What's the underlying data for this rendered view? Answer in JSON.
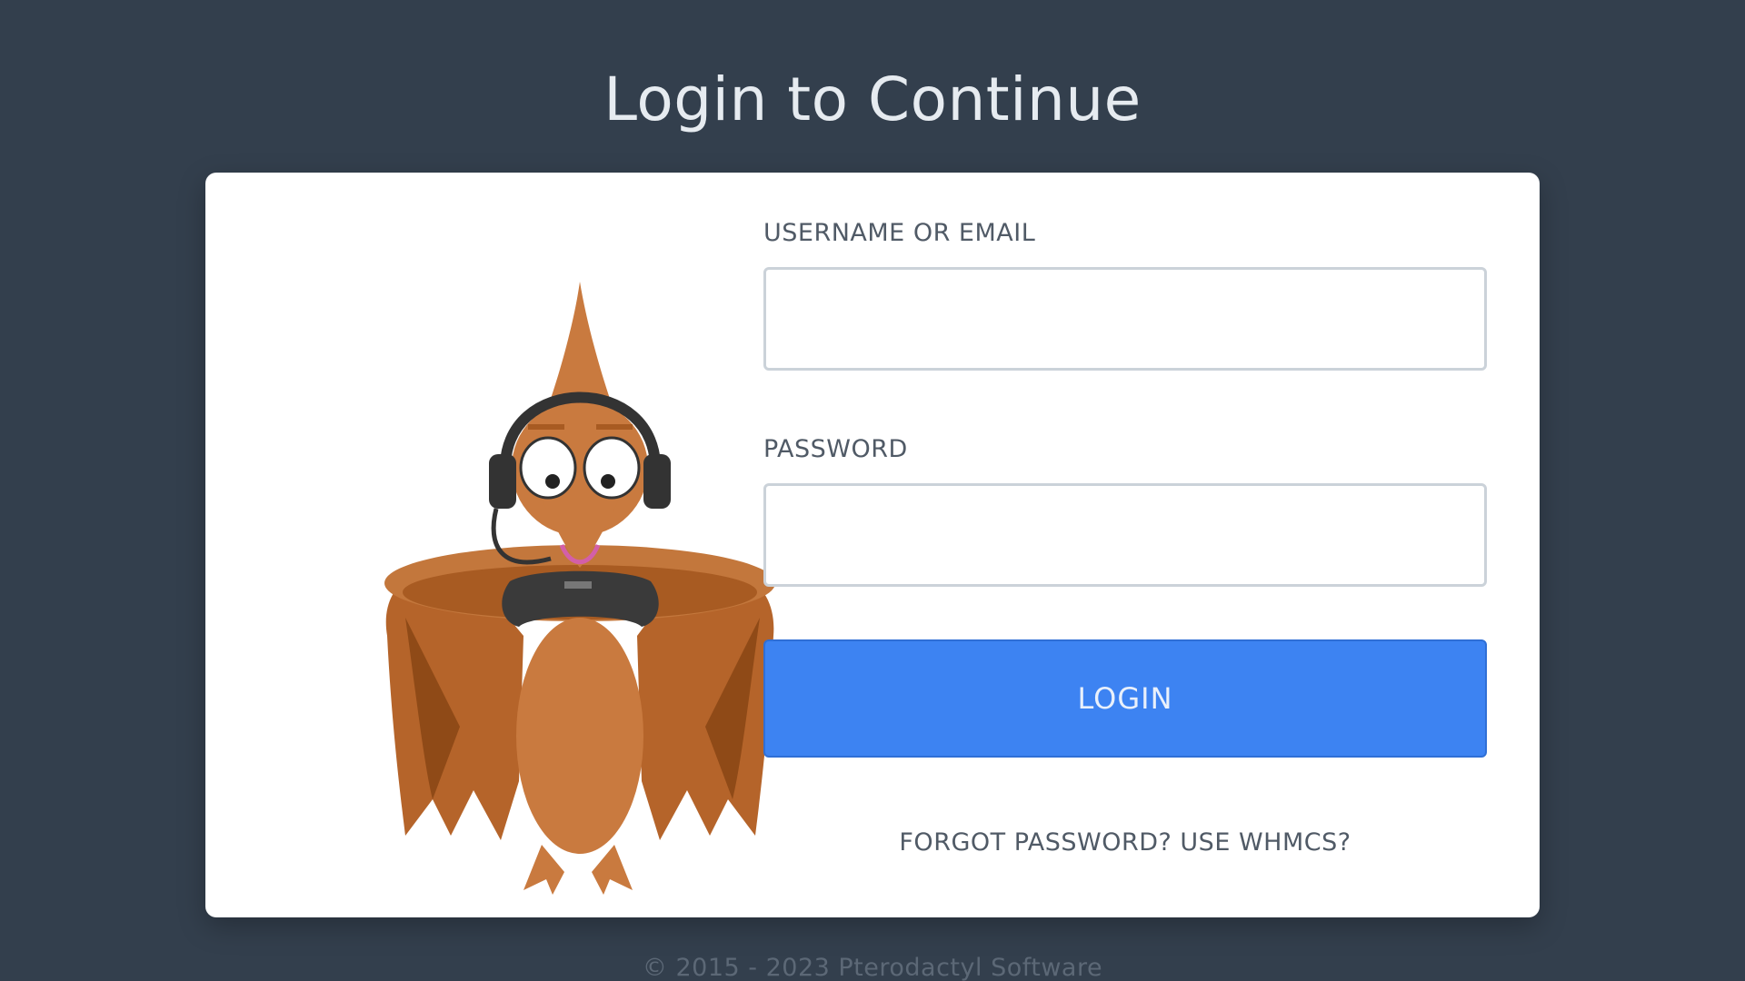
{
  "page": {
    "title": "Login to Continue",
    "background_color": "#333f4d",
    "accent_color": "#3d83f2"
  },
  "login_form": {
    "username_label": "USERNAME OR EMAIL",
    "username_value": "",
    "password_label": "PASSWORD",
    "password_value": "",
    "login_button_label": "LOGIN",
    "forgot_link_label": "FORGOT PASSWORD? USE WHMCS?"
  },
  "mascot": {
    "icon": "pterodactyl-gamer-mascot"
  },
  "footer": {
    "copyright": "© 2015 - 2023 Pterodactyl Software"
  }
}
